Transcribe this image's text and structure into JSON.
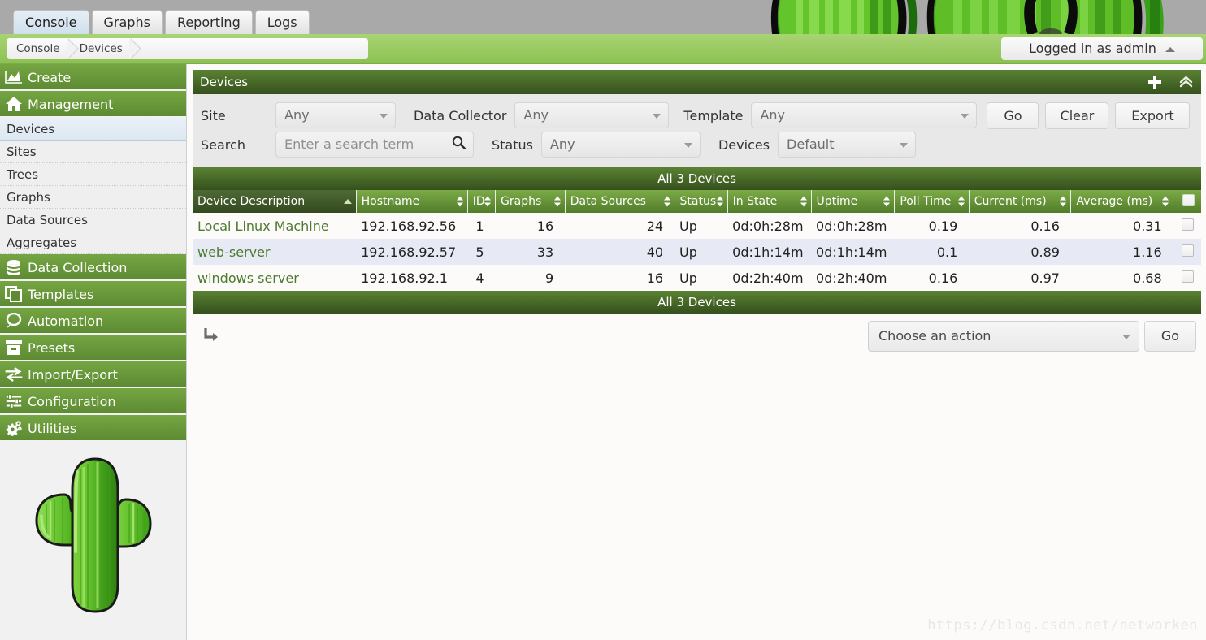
{
  "app": {
    "title": "Cacti - Devices",
    "accent_green": "#5d8a33",
    "header_dark": "#35501d",
    "link_green": "#4c7a2e",
    "status_up_color": "#8fb96a"
  },
  "topnav": {
    "tabs": [
      {
        "label": "Console",
        "active": true
      },
      {
        "label": "Graphs",
        "active": false
      },
      {
        "label": "Reporting",
        "active": false
      },
      {
        "label": "Logs",
        "active": false
      }
    ]
  },
  "breadcrumb": {
    "items": [
      "Console",
      "Devices"
    ],
    "login_label": "Logged in as admin"
  },
  "sidebar": {
    "groups": [
      {
        "type": "head",
        "label": "Create",
        "icon": "chart-area-icon"
      },
      {
        "type": "head",
        "label": "Management",
        "icon": "home-icon"
      },
      {
        "type": "item",
        "label": "Devices",
        "selected": true
      },
      {
        "type": "item",
        "label": "Sites",
        "selected": false
      },
      {
        "type": "item",
        "label": "Trees",
        "selected": false
      },
      {
        "type": "item",
        "label": "Graphs",
        "selected": false
      },
      {
        "type": "item",
        "label": "Data Sources",
        "selected": false
      },
      {
        "type": "item",
        "label": "Aggregates",
        "selected": false
      },
      {
        "type": "head",
        "label": "Data Collection",
        "icon": "database-icon"
      },
      {
        "type": "head",
        "label": "Templates",
        "icon": "copy-icon"
      },
      {
        "type": "head",
        "label": "Automation",
        "icon": "lasso-icon"
      },
      {
        "type": "head",
        "label": "Presets",
        "icon": "archive-icon"
      },
      {
        "type": "head",
        "label": "Import/Export",
        "icon": "exchange-icon"
      },
      {
        "type": "head",
        "label": "Configuration",
        "icon": "sliders-icon"
      },
      {
        "type": "head",
        "label": "Utilities",
        "icon": "cogs-icon"
      }
    ],
    "logo_alt": "cactus-logo"
  },
  "panel": {
    "title": "Devices",
    "add_icon": "plus-icon",
    "collapse_icon": "double-chevron-up-icon"
  },
  "filters": {
    "site_label": "Site",
    "site_value": "Any",
    "data_collector_label": "Data Collector",
    "data_collector_value": "Any",
    "template_label": "Template",
    "template_value": "Any",
    "go_label": "Go",
    "clear_label": "Clear",
    "export_label": "Export",
    "search_label": "Search",
    "search_value": "",
    "search_placeholder": "Enter a search term",
    "search_icon": "magnifier-icon",
    "status_label": "Status",
    "status_value": "Any",
    "devices_label": "Devices",
    "devices_value": "Default"
  },
  "table": {
    "caption_top": "All 3 Devices",
    "caption_bottom": "All 3 Devices",
    "sorted_column": "Device Description",
    "sort_direction": "asc",
    "columns": [
      {
        "label": "Device Description",
        "align": "left",
        "sortable": true,
        "sorted": true
      },
      {
        "label": "Hostname",
        "align": "left",
        "sortable": true,
        "sorted": false
      },
      {
        "label": "ID",
        "align": "left",
        "sortable": true,
        "sorted": false
      },
      {
        "label": "Graphs",
        "align": "left",
        "sortable": true,
        "sorted": false
      },
      {
        "label": "Data Sources",
        "align": "left",
        "sortable": true,
        "sorted": false
      },
      {
        "label": "Status",
        "align": "left",
        "sortable": true,
        "sorted": false
      },
      {
        "label": "In State",
        "align": "left",
        "sortable": true,
        "sorted": false
      },
      {
        "label": "Uptime",
        "align": "left",
        "sortable": true,
        "sorted": false
      },
      {
        "label": "Poll Time",
        "align": "left",
        "sortable": true,
        "sorted": false
      },
      {
        "label": "Current (ms)",
        "align": "left",
        "sortable": true,
        "sorted": false
      },
      {
        "label": "Average (ms)",
        "align": "left",
        "sortable": true,
        "sorted": false
      },
      {
        "label": "",
        "align": "center",
        "sortable": false,
        "sorted": false
      }
    ],
    "rows": [
      {
        "description": "Local Linux Machine",
        "hostname": "192.168.92.56",
        "id": "1",
        "graphs": "16",
        "data_sources": "24",
        "status": "Up",
        "in_state": "0d:0h:28m",
        "uptime": "0d:0h:28m",
        "poll_time": "0.19",
        "current_ms": "0.16",
        "average_ms": "0.31",
        "checked": false
      },
      {
        "description": "web-server",
        "hostname": "192.168.92.57",
        "id": "5",
        "graphs": "33",
        "data_sources": "40",
        "status": "Up",
        "in_state": "0d:1h:14m",
        "uptime": "0d:1h:14m",
        "poll_time": "0.1",
        "current_ms": "0.89",
        "average_ms": "1.16",
        "checked": false
      },
      {
        "description": "windows server",
        "hostname": "192.168.92.1",
        "id": "4",
        "graphs": "9",
        "data_sources": "16",
        "status": "Up",
        "in_state": "0d:2h:40m",
        "uptime": "0d:2h:40m",
        "poll_time": "0.16",
        "current_ms": "0.97",
        "average_ms": "0.68",
        "checked": false
      }
    ]
  },
  "actions": {
    "sub_arrow_icon": "corner-down-right-icon",
    "action_value": "Choose an action",
    "go_label": "Go"
  },
  "watermark": {
    "text": "https://blog.csdn.net/networken"
  }
}
